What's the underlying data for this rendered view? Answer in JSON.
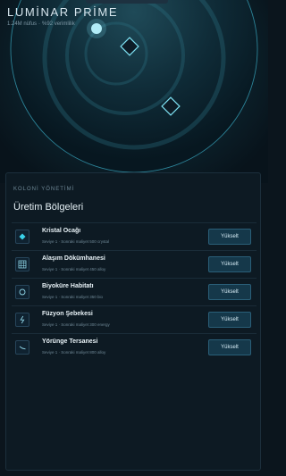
{
  "header": {
    "title": "LUMİNAR PRİME",
    "population": "1.24M nüfus",
    "efficiency": "%92 verimlilik",
    "separator": "·"
  },
  "colors": {
    "background": "#0b151d",
    "panel": "#0d1a23",
    "accent": "#2fd0e6",
    "button": "#15384a"
  },
  "panel": {
    "eyebrow": "KOLONİ YÖNETİMİ",
    "title": "Üretim Bölgeleri"
  },
  "districts": [
    {
      "name": "Kristal Ocağı",
      "meta": "Seviye 1 · Sonraki maliyet 500 crystal",
      "action": "Yükselt",
      "icon": "crystal-icon"
    },
    {
      "name": "Alaşım Dökümhanesi",
      "meta": "Seviye 1 · Sonraki maliyet 450 alloy",
      "action": "Yükselt",
      "icon": "grid-icon"
    },
    {
      "name": "Biyoküre Habitatı",
      "meta": "Seviye 1 · Sonraki maliyet 350 bio",
      "action": "Yükselt",
      "icon": "orb-icon"
    },
    {
      "name": "Füzyon Şebekesi",
      "meta": "Seviye 1 · Sonraki maliyet 300 energy",
      "action": "Yükselt",
      "icon": "bolt-icon"
    },
    {
      "name": "Yörünge Tersanesi",
      "meta": "Seviye 1 · Sonraki maliyet 800 alloy",
      "action": "Yükselt",
      "icon": "ship-icon"
    }
  ]
}
